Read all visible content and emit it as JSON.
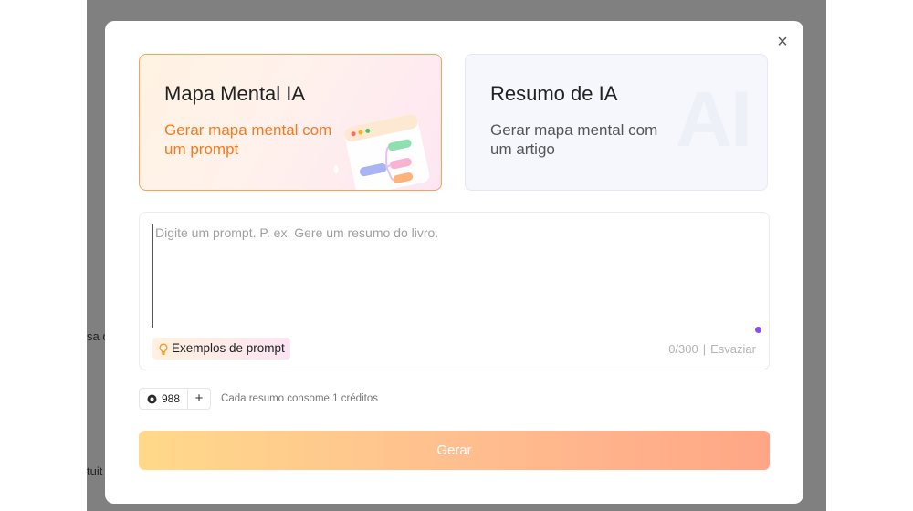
{
  "background": {
    "fragments": [
      "sa d",
      "tuit"
    ]
  },
  "modal": {
    "close_icon": "close-icon",
    "cards": [
      {
        "title": "Mapa Mental IA",
        "description": "Gerar mapa mental com um prompt",
        "selected": true,
        "accent": "#f27b22"
      },
      {
        "title": "Resumo de IA",
        "description": "Gerar mapa mental com um artigo",
        "selected": false,
        "watermark": "AI"
      }
    ],
    "prompt": {
      "placeholder": "Digite um prompt. P. ex. Gere um resumo do livro.",
      "value": "",
      "examples_label": "Exemplos de prompt",
      "examples_icon": "lightbulb-icon",
      "counter": "0/300",
      "separator": "|",
      "clear_label": "Esvaziar"
    },
    "credits": {
      "count": "988",
      "plus": "+",
      "info": "Cada resumo consome 1 créditos"
    },
    "generate_label": "Gerar",
    "colors": {
      "accent": "#f27b22",
      "dot": "#8a4ef0"
    }
  }
}
